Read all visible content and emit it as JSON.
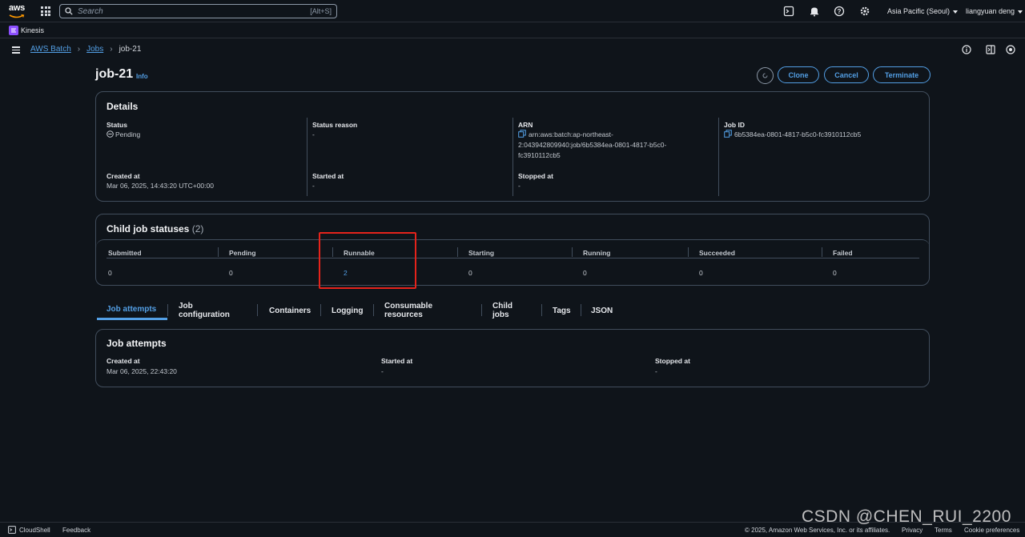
{
  "topnav": {
    "logo_text": "aws",
    "search_placeholder": "Search",
    "search_shortcut": "[Alt+S]",
    "region": "Asia Pacific (Seoul)",
    "user": "liangyuan deng"
  },
  "favorites": {
    "kinesis": "Kinesis"
  },
  "breadcrumb": {
    "root": "AWS Batch",
    "jobs": "Jobs",
    "current": "job-21"
  },
  "header": {
    "title": "job-21",
    "info": "Info",
    "clone": "Clone",
    "cancel": "Cancel",
    "terminate": "Terminate"
  },
  "details": {
    "title": "Details",
    "status_label": "Status",
    "status_value": "Pending",
    "status_reason_label": "Status reason",
    "status_reason_value": "-",
    "arn_label": "ARN",
    "arn_line1": "arn:aws:batch:ap-northeast-",
    "arn_line2": "2:043942809940:job/6b5384ea-0801-4817-b5c0-",
    "arn_line3": "fc3910112cb5",
    "jobid_label": "Job ID",
    "jobid_value": "6b5384ea-0801-4817-b5c0-fc3910112cb5",
    "created_label": "Created at",
    "created_value": "Mar 06, 2025, 14:43:20 UTC+00:00",
    "started_label": "Started at",
    "started_value": "-",
    "stopped_label": "Stopped at",
    "stopped_value": "-"
  },
  "child_statuses": {
    "title": "Child job statuses",
    "count": "(2)",
    "columns": [
      "Submitted",
      "Pending",
      "Runnable",
      "Starting",
      "Running",
      "Succeeded",
      "Failed"
    ],
    "values": [
      "0",
      "0",
      "2",
      "0",
      "0",
      "0",
      "0"
    ]
  },
  "tabs": [
    "Job attempts",
    "Job configuration",
    "Containers",
    "Logging",
    "Consumable resources",
    "Child jobs",
    "Tags",
    "JSON"
  ],
  "job_attempts": {
    "title": "Job attempts",
    "created_label": "Created at",
    "created_value": "Mar 06, 2025, 22:43:20",
    "started_label": "Started at",
    "started_value": "-",
    "stopped_label": "Stopped at",
    "stopped_value": "-"
  },
  "footer": {
    "cloudshell": "CloudShell",
    "feedback": "Feedback",
    "copyright": "© 2025, Amazon Web Services, Inc. or its affiliates.",
    "privacy": "Privacy",
    "terms": "Terms",
    "cookies": "Cookie preferences"
  },
  "watermark": "CSDN @CHEN_RUI_2200",
  "colors": {
    "accent": "#539fe5",
    "background": "#0f141a",
    "border": "#414d5c",
    "highlight": "#e5231b",
    "kinesis": "#8c4fff"
  }
}
